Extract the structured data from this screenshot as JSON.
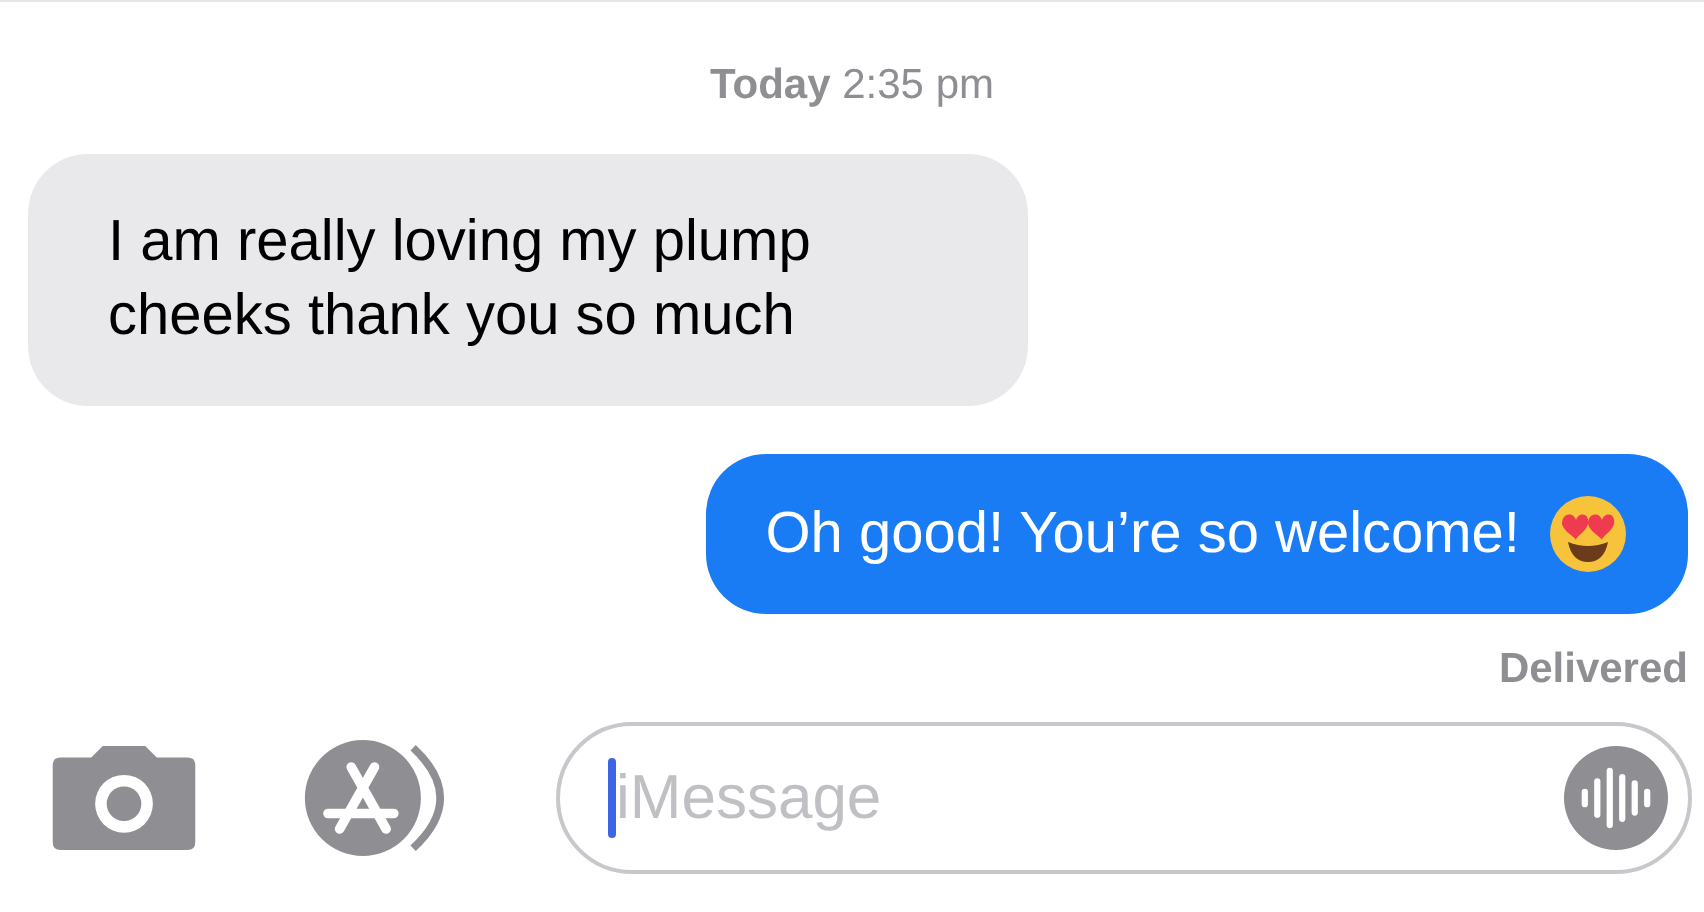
{
  "timestamp": {
    "day": "Today",
    "time": "2:35 pm"
  },
  "messages": [
    {
      "kind": "received",
      "text": "I am really loving my plump cheeks thank you so much"
    },
    {
      "kind": "sent",
      "text": "Oh good! You’re so welcome!",
      "emoji": true
    }
  ],
  "status": "Delivered",
  "composer": {
    "placeholder": "iMessage"
  }
}
